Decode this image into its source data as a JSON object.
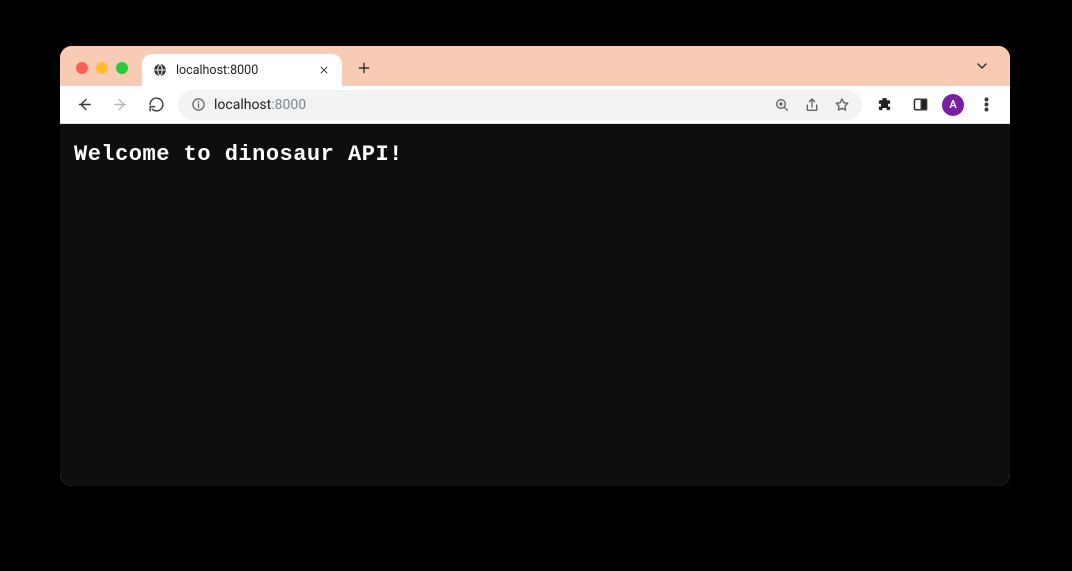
{
  "window": {
    "traffic_lights": {
      "red": "#ff5f57",
      "yellow": "#febc2e",
      "green": "#28c840"
    }
  },
  "tabs": {
    "active": {
      "title": "localhost:8000",
      "favicon": "globe-icon"
    }
  },
  "toolbar": {
    "back_enabled": true,
    "forward_enabled": false,
    "url": {
      "host": "localhost",
      "port": ":8000"
    },
    "profile_initial": "A"
  },
  "page": {
    "heading": "Welcome to dinosaur API!"
  },
  "colors": {
    "tabstrip": "#f7cbb4",
    "content_bg": "#0e0e0e",
    "avatar": "#7b1fa2"
  }
}
